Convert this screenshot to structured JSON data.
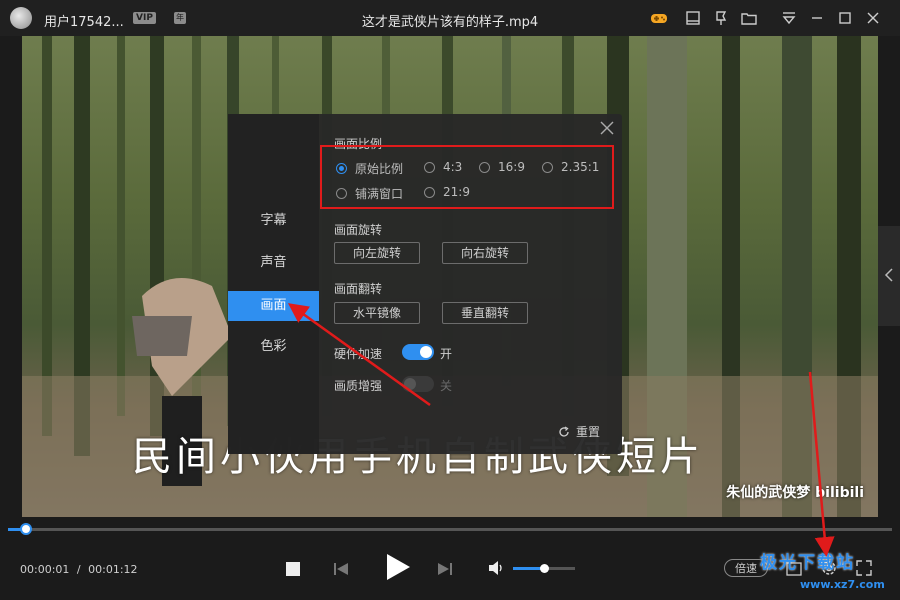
{
  "titlebar": {
    "username": "用户17542...",
    "vip_badge": "VIP",
    "level_badge": "年",
    "file_title": "这才是武侠片该有的样子.mp4"
  },
  "video": {
    "subtitle": "民间小伙用手机自制武侠短片",
    "watermark": "朱仙的武侠梦 bilibili"
  },
  "settings_panel": {
    "nav": [
      {
        "label": "字幕"
      },
      {
        "label": "声音"
      },
      {
        "label": "画面",
        "active": true
      },
      {
        "label": "色彩"
      }
    ],
    "aspect": {
      "title": "画面比例",
      "options": [
        {
          "label": "原始比例",
          "checked": true
        },
        {
          "label": "4:3"
        },
        {
          "label": "16:9"
        },
        {
          "label": "2.35:1"
        },
        {
          "label": "铺满窗口"
        },
        {
          "label": "21:9"
        }
      ]
    },
    "rotate": {
      "title": "画面旋转",
      "left_label": "向左旋转",
      "right_label": "向右旋转"
    },
    "flip": {
      "title": "画面翻转",
      "horizontal_label": "水平镜像",
      "vertical_label": "垂直翻转"
    },
    "hw_accel": {
      "label": "硬件加速",
      "state": "开",
      "on": true
    },
    "quality": {
      "label": "画质增强",
      "state": "关",
      "on": false
    },
    "reset_label": "重置"
  },
  "player": {
    "current_time": "00:00:01",
    "separator": "/",
    "total_time": "00:01:12",
    "progress_fraction": 0.02,
    "volume_fraction": 0.5,
    "speed_label": "倍速"
  },
  "site_logo": {
    "name": "极光下载站",
    "url": "www.xz7.com"
  },
  "colors": {
    "accent": "#2f8ff0",
    "highlight": "#e01b1b",
    "game_icon": "#f5a623"
  }
}
